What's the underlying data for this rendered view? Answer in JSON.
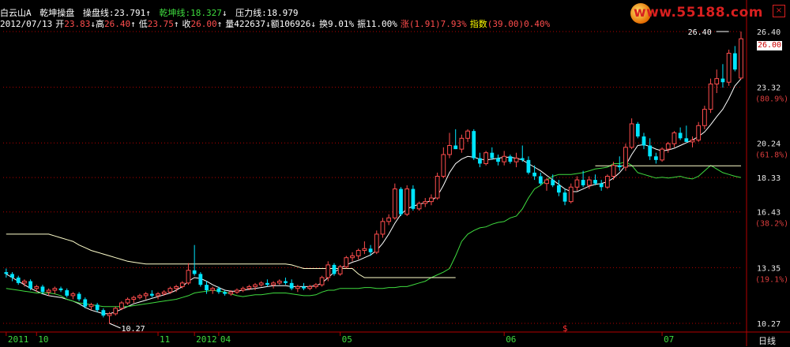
{
  "header": {
    "stock_name": "白云山A",
    "indicator_name": "乾坤操盘",
    "cp_label": "操盘线:",
    "cp_value": "23.791",
    "cp_arrow": "↑",
    "qk_label": "乾坤线:",
    "qk_value": "18.327",
    "qk_arrow": "↓",
    "yl_label": "压力线:",
    "yl_value": "18.979"
  },
  "quote": {
    "date": "2012/07/13",
    "open_label": "开",
    "open": "23.83",
    "open_arrow": "↓",
    "high_label": "高",
    "high": "26.40",
    "high_arrow": "↑",
    "low_label": "低",
    "low": "23.75",
    "low_arrow": "↑",
    "close_label": "收",
    "close": "26.00",
    "close_arrow": "↑",
    "vol_label": "量",
    "volume": "422637",
    "vol_arrow": "↓",
    "amt_label": "额",
    "amount": "106926",
    "amt_arrow": "↓",
    "turn_label": "换",
    "turnover": "9.01%",
    "amp_label": "振",
    "amplitude": "11.00%",
    "chg_label": "涨",
    "change": "(1.91)7.93%",
    "idx_label": "指数",
    "index": "(39.00)0.40%"
  },
  "watermark": "www.55188.com",
  "close_icon": "close-icon",
  "price_tag": "26.00",
  "marker": "$",
  "period_label": "日线",
  "colors": {
    "background": "#000000",
    "up_candle": "#ff4d4d",
    "down_candle": "#00e5ff",
    "operating_line": "#ffffff",
    "qiankun_line": "#3fdc3f",
    "pressure_line": "#ffffcc",
    "axis": "#b40000",
    "watermark": "#d81f1f"
  },
  "chart_data": {
    "type": "candlestick",
    "y_ticks": [
      {
        "value": 26.4,
        "label": "26.40",
        "pct": ""
      },
      {
        "value": 23.32,
        "label": "23.32",
        "pct": "(80.9%)"
      },
      {
        "value": 20.24,
        "label": "20.24",
        "pct": "(61.8%)"
      },
      {
        "value": 18.33,
        "label": "18.33",
        "pct": ""
      },
      {
        "value": 16.43,
        "label": "16.43",
        "pct": "(38.2%)"
      },
      {
        "value": 13.35,
        "label": "13.35",
        "pct": "(19.1%)"
      },
      {
        "value": 10.27,
        "label": "10.27",
        "pct": ""
      }
    ],
    "ylim": [
      10.27,
      26.4
    ],
    "x_labels": [
      {
        "label": "2011",
        "index": 0
      },
      {
        "label": "10",
        "index": 5
      },
      {
        "label": "11",
        "index": 25
      },
      {
        "label": "2012",
        "index": 31
      },
      {
        "label": "04",
        "index": 35
      },
      {
        "label": "05",
        "index": 55
      },
      {
        "label": "06",
        "index": 82
      },
      {
        "label": "07",
        "index": 108
      }
    ],
    "high_annotation": {
      "label": "26.40",
      "value": 26.4,
      "index": 119
    },
    "low_annotation": {
      "label": "10.27",
      "value": 10.27,
      "index": 17
    },
    "candles": [
      [
        13.1,
        13.3,
        12.8,
        13.0
      ],
      [
        13.0,
        13.1,
        12.6,
        12.8
      ],
      [
        12.8,
        12.9,
        12.4,
        12.5
      ],
      [
        12.5,
        12.7,
        12.3,
        12.6
      ],
      [
        12.6,
        12.7,
        12.1,
        12.2
      ],
      [
        12.2,
        12.4,
        12.0,
        12.3
      ],
      [
        12.3,
        12.4,
        11.9,
        12.0
      ],
      [
        12.0,
        12.2,
        11.8,
        12.1
      ],
      [
        12.1,
        12.3,
        11.9,
        12.2
      ],
      [
        12.2,
        12.3,
        12.0,
        12.1
      ],
      [
        12.1,
        12.2,
        11.7,
        11.8
      ],
      [
        11.8,
        12.0,
        11.6,
        11.9
      ],
      [
        11.9,
        12.0,
        11.5,
        11.6
      ],
      [
        11.6,
        11.7,
        11.1,
        11.2
      ],
      [
        11.2,
        11.4,
        11.0,
        11.3
      ],
      [
        11.3,
        11.4,
        10.9,
        11.0
      ],
      [
        11.0,
        11.1,
        10.6,
        10.7
      ],
      [
        10.7,
        10.9,
        10.27,
        10.8
      ],
      [
        10.8,
        11.2,
        10.7,
        11.1
      ],
      [
        11.1,
        11.5,
        11.0,
        11.4
      ],
      [
        11.4,
        11.7,
        11.3,
        11.6
      ],
      [
        11.6,
        11.8,
        11.4,
        11.7
      ],
      [
        11.7,
        11.9,
        11.6,
        11.8
      ],
      [
        11.8,
        12.0,
        11.6,
        11.9
      ],
      [
        11.9,
        12.1,
        11.7,
        11.8
      ],
      [
        11.8,
        12.0,
        11.6,
        11.9
      ],
      [
        11.9,
        12.1,
        11.8,
        12.0
      ],
      [
        12.0,
        12.3,
        11.9,
        12.2
      ],
      [
        12.2,
        12.4,
        12.0,
        12.3
      ],
      [
        12.3,
        12.6,
        12.2,
        12.5
      ],
      [
        12.5,
        13.6,
        12.4,
        13.2
      ],
      [
        13.2,
        14.6,
        12.9,
        13.0
      ],
      [
        13.0,
        13.1,
        12.3,
        12.4
      ],
      [
        12.4,
        12.6,
        11.9,
        12.1
      ],
      [
        12.1,
        12.3,
        11.9,
        12.2
      ],
      [
        12.2,
        12.3,
        11.9,
        12.0
      ],
      [
        12.0,
        12.1,
        11.8,
        11.9
      ],
      [
        11.9,
        12.1,
        11.8,
        12.0
      ],
      [
        12.0,
        12.2,
        11.9,
        12.1
      ],
      [
        12.1,
        12.3,
        12.0,
        12.2
      ],
      [
        12.2,
        12.4,
        12.1,
        12.3
      ],
      [
        12.3,
        12.5,
        12.1,
        12.4
      ],
      [
        12.4,
        12.6,
        12.3,
        12.5
      ],
      [
        12.5,
        12.7,
        12.3,
        12.4
      ],
      [
        12.4,
        12.6,
        12.2,
        12.5
      ],
      [
        12.5,
        12.7,
        12.4,
        12.6
      ],
      [
        12.6,
        12.8,
        12.4,
        12.5
      ],
      [
        12.5,
        12.7,
        12.1,
        12.2
      ],
      [
        12.2,
        12.4,
        12.0,
        12.3
      ],
      [
        12.3,
        12.5,
        12.1,
        12.2
      ],
      [
        12.2,
        12.4,
        12.1,
        12.3
      ],
      [
        12.3,
        12.5,
        12.2,
        12.4
      ],
      [
        12.4,
        12.9,
        12.3,
        12.8
      ],
      [
        12.8,
        13.7,
        12.6,
        13.5
      ],
      [
        13.5,
        13.6,
        12.9,
        13.0
      ],
      [
        13.0,
        13.5,
        12.9,
        13.4
      ],
      [
        13.4,
        14.0,
        13.3,
        13.9
      ],
      [
        13.9,
        14.2,
        13.7,
        14.0
      ],
      [
        14.0,
        14.4,
        13.8,
        14.3
      ],
      [
        14.3,
        14.8,
        14.1,
        14.4
      ],
      [
        14.4,
        14.6,
        14.0,
        14.2
      ],
      [
        14.2,
        15.4,
        14.1,
        15.2
      ],
      [
        15.2,
        16.1,
        15.0,
        15.9
      ],
      [
        15.9,
        16.3,
        15.7,
        16.1
      ],
      [
        16.1,
        18.0,
        16.0,
        17.7
      ],
      [
        17.7,
        17.8,
        16.2,
        16.3
      ],
      [
        16.3,
        17.9,
        16.2,
        17.7
      ],
      [
        17.7,
        17.9,
        16.5,
        16.6
      ],
      [
        16.6,
        17.0,
        16.5,
        16.9
      ],
      [
        16.9,
        17.2,
        16.7,
        17.0
      ],
      [
        17.0,
        17.4,
        16.8,
        17.2
      ],
      [
        17.2,
        18.6,
        17.1,
        18.4
      ],
      [
        18.4,
        20.0,
        18.3,
        19.6
      ],
      [
        19.6,
        20.8,
        19.4,
        20.1
      ],
      [
        20.1,
        21.0,
        19.9,
        19.9
      ],
      [
        19.9,
        20.7,
        19.7,
        20.5
      ],
      [
        20.5,
        21.0,
        20.3,
        20.9
      ],
      [
        20.9,
        21.0,
        19.3,
        19.4
      ],
      [
        19.4,
        19.7,
        18.9,
        19.1
      ],
      [
        19.1,
        19.8,
        19.0,
        19.7
      ],
      [
        19.7,
        20.0,
        19.3,
        19.4
      ],
      [
        19.4,
        19.6,
        19.0,
        19.2
      ],
      [
        19.2,
        19.8,
        19.0,
        19.5
      ],
      [
        19.5,
        19.6,
        19.1,
        19.2
      ],
      [
        19.2,
        19.7,
        18.9,
        19.4
      ],
      [
        19.4,
        20.1,
        19.2,
        19.3
      ],
      [
        19.3,
        19.5,
        18.5,
        18.6
      ],
      [
        18.6,
        19.0,
        18.2,
        18.4
      ],
      [
        18.4,
        18.6,
        17.9,
        18.0
      ],
      [
        18.0,
        18.3,
        17.6,
        18.2
      ],
      [
        18.2,
        18.5,
        17.8,
        17.9
      ],
      [
        17.9,
        18.2,
        17.3,
        17.5
      ],
      [
        17.5,
        17.7,
        16.8,
        17.0
      ],
      [
        17.0,
        18.0,
        16.9,
        17.8
      ],
      [
        17.8,
        18.4,
        17.6,
        18.2
      ],
      [
        18.2,
        18.7,
        17.8,
        17.9
      ],
      [
        17.9,
        18.4,
        17.7,
        18.2
      ],
      [
        18.2,
        18.5,
        17.9,
        18.0
      ],
      [
        18.0,
        18.2,
        17.6,
        17.8
      ],
      [
        17.8,
        18.5,
        17.7,
        18.4
      ],
      [
        18.4,
        19.2,
        18.2,
        19.0
      ],
      [
        19.0,
        19.5,
        18.7,
        18.9
      ],
      [
        18.9,
        20.2,
        18.7,
        20.0
      ],
      [
        20.0,
        21.6,
        19.9,
        21.3
      ],
      [
        21.3,
        21.4,
        20.5,
        20.6
      ],
      [
        20.6,
        20.8,
        19.9,
        20.1
      ],
      [
        20.1,
        20.5,
        19.3,
        19.5
      ],
      [
        19.5,
        19.7,
        19.1,
        19.3
      ],
      [
        19.3,
        20.0,
        19.2,
        19.9
      ],
      [
        19.9,
        20.3,
        19.7,
        20.2
      ],
      [
        20.2,
        20.9,
        20.0,
        20.8
      ],
      [
        20.8,
        21.1,
        20.4,
        20.5
      ],
      [
        20.5,
        21.2,
        20.3,
        20.3
      ],
      [
        20.3,
        20.6,
        20.0,
        20.4
      ],
      [
        20.4,
        21.4,
        20.3,
        21.2
      ],
      [
        21.2,
        22.3,
        21.0,
        22.1
      ],
      [
        22.1,
        23.8,
        21.9,
        23.5
      ],
      [
        23.5,
        24.3,
        23.0,
        23.8
      ],
      [
        23.8,
        24.6,
        23.3,
        23.6
      ],
      [
        23.6,
        25.4,
        23.4,
        25.2
      ],
      [
        25.2,
        25.6,
        24.2,
        24.3
      ],
      [
        23.83,
        26.4,
        23.75,
        26.0
      ]
    ],
    "series": [
      {
        "key": "operating_line",
        "values": [
          13.0,
          12.8,
          12.6,
          12.4,
          12.2,
          12.05,
          11.9,
          11.8,
          11.75,
          11.7,
          11.6,
          11.5,
          11.35,
          11.15,
          11.0,
          10.9,
          10.8,
          10.8,
          10.9,
          11.05,
          11.2,
          11.35,
          11.45,
          11.55,
          11.65,
          11.75,
          11.85,
          11.95,
          12.1,
          12.3,
          12.6,
          12.8,
          12.75,
          12.6,
          12.4,
          12.25,
          12.1,
          12.05,
          12.05,
          12.1,
          12.15,
          12.2,
          12.25,
          12.3,
          12.35,
          12.35,
          12.35,
          12.3,
          12.3,
          12.3,
          12.3,
          12.35,
          12.5,
          12.8,
          13.1,
          13.3,
          13.5,
          13.65,
          13.75,
          13.9,
          14.05,
          14.3,
          14.7,
          15.2,
          15.8,
          16.3,
          16.6,
          16.75,
          16.85,
          16.95,
          17.05,
          17.3,
          17.9,
          18.6,
          19.1,
          19.35,
          19.5,
          19.45,
          19.35,
          19.3,
          19.35,
          19.4,
          19.45,
          19.45,
          19.4,
          19.3,
          19.1,
          18.9,
          18.7,
          18.45,
          18.2,
          17.95,
          17.7,
          17.55,
          17.55,
          17.7,
          17.85,
          17.95,
          18.0,
          18.1,
          18.3,
          18.6,
          19.0,
          19.6,
          20.1,
          20.15,
          20.05,
          19.9,
          19.8,
          19.85,
          19.95,
          20.1,
          20.25,
          20.4,
          20.6,
          20.85,
          21.25,
          21.7,
          22.1,
          22.7,
          23.4,
          23.79
        ]
      },
      {
        "key": "qiankun_line",
        "values": [
          12.2,
          12.15,
          12.1,
          12.05,
          12.0,
          11.95,
          11.95,
          11.95,
          11.9,
          11.8,
          11.6,
          11.5,
          11.4,
          11.35,
          11.3,
          11.25,
          11.2,
          11.2,
          11.2,
          11.2,
          11.2,
          11.25,
          11.3,
          11.35,
          11.4,
          11.45,
          11.5,
          11.55,
          11.6,
          11.7,
          11.8,
          11.95,
          12.0,
          12.05,
          12.1,
          12.05,
          12.0,
          11.9,
          11.8,
          11.75,
          11.8,
          11.85,
          11.85,
          11.9,
          11.95,
          11.95,
          11.95,
          11.9,
          11.85,
          11.8,
          11.8,
          11.85,
          12.0,
          12.1,
          12.1,
          12.2,
          12.2,
          12.2,
          12.2,
          12.25,
          12.25,
          12.2,
          12.2,
          12.25,
          12.25,
          12.3,
          12.3,
          12.4,
          12.5,
          12.6,
          12.8,
          12.95,
          13.1,
          13.3,
          14.0,
          14.8,
          15.2,
          15.4,
          15.55,
          15.6,
          15.75,
          15.85,
          15.9,
          16.1,
          16.2,
          16.6,
          17.2,
          17.7,
          17.9,
          18.2,
          18.4,
          18.5,
          18.5,
          18.5,
          18.55,
          18.6,
          18.7,
          18.8,
          18.85,
          18.9,
          19.1,
          19.1,
          19.2,
          19.0,
          18.6,
          18.5,
          18.4,
          18.3,
          18.35,
          18.3,
          18.35,
          18.4,
          18.3,
          18.25,
          18.4,
          18.7,
          19.0,
          18.8,
          18.6,
          18.5,
          18.4,
          18.33
        ]
      },
      {
        "key": "pressure_line",
        "values": [
          15.2,
          15.2,
          15.2,
          15.2,
          15.2,
          15.2,
          15.2,
          15.2,
          15.1,
          15.0,
          14.9,
          14.8,
          14.6,
          14.45,
          14.3,
          14.2,
          14.1,
          14.0,
          13.9,
          13.8,
          13.7,
          13.65,
          13.6,
          13.55,
          13.55,
          13.55,
          13.55,
          13.55,
          13.55,
          13.55,
          13.55,
          13.55,
          13.55,
          13.55,
          13.55,
          13.55,
          13.55,
          13.55,
          13.55,
          13.55,
          13.55,
          13.55,
          13.55,
          13.55,
          13.55,
          13.55,
          13.55,
          13.5,
          13.4,
          13.3,
          13.3,
          13.3,
          13.3,
          13.3,
          13.3,
          13.3,
          13.3,
          13.3,
          13.0,
          12.8,
          12.8,
          12.8,
          12.8,
          12.8,
          12.8,
          12.8,
          12.8,
          12.8,
          12.8,
          12.8,
          12.8,
          12.8,
          12.8,
          12.8,
          12.8,
          null,
          null,
          null,
          null,
          null,
          null,
          null,
          null,
          null,
          null,
          null,
          null,
          null,
          null,
          null,
          null,
          null,
          null,
          null,
          null,
          null,
          null,
          18.98,
          18.98,
          18.98,
          18.98,
          18.98,
          18.98,
          18.98,
          18.98,
          18.98,
          18.98,
          18.98,
          18.98,
          18.98,
          18.98,
          18.98,
          18.98,
          18.98,
          18.98,
          18.98,
          18.98,
          18.98,
          18.98,
          18.98,
          18.98,
          18.98
        ]
      }
    ]
  }
}
